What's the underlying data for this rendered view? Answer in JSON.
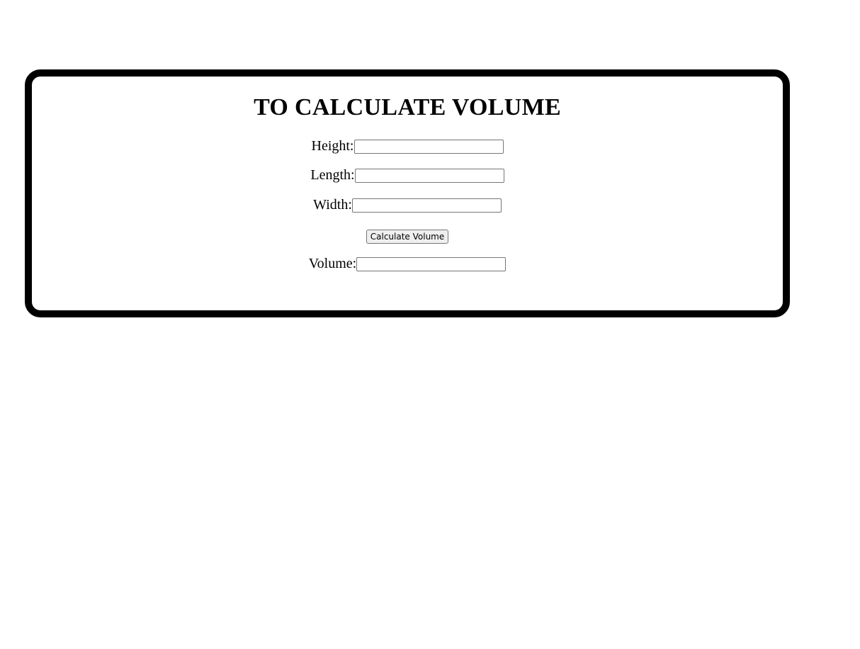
{
  "form": {
    "title": "TO CALCULATE VOLUME",
    "height_label": "Height:",
    "height_value": "",
    "length_label": "Length:",
    "length_value": "",
    "width_label": "Width:",
    "width_value": "",
    "calculate_button_label": "Calculate Volume",
    "volume_label": "Volume:",
    "volume_value": ""
  }
}
